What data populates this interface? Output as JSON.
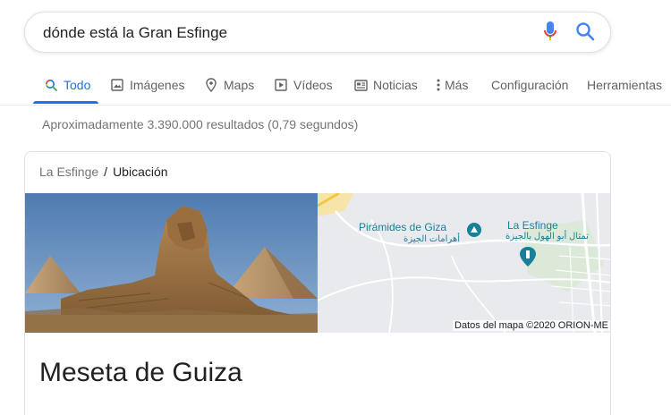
{
  "search": {
    "query": "dónde está la Gran Esfinge"
  },
  "tabs": [
    {
      "label": "Todo",
      "icon": "search-icon",
      "active": true
    },
    {
      "label": "Imágenes",
      "icon": "image-icon"
    },
    {
      "label": "Maps",
      "icon": "map-pin-icon"
    },
    {
      "label": "Vídeos",
      "icon": "play-icon"
    },
    {
      "label": "Noticias",
      "icon": "news-icon"
    },
    {
      "label": "Más",
      "icon": "more-vert-icon"
    },
    {
      "label": "Configuración"
    },
    {
      "label": "Herramientas"
    }
  ],
  "result_stats": "Aproximadamente 3.390.000 resultados (0,79 segundos)",
  "card": {
    "breadcrumb": {
      "parent": "La Esfinge",
      "separator": "/",
      "current": "Ubicación"
    },
    "map": {
      "label_pyramids": "Pirámides de Giza",
      "label_pyramids_ar": "أهرامات الجيزة",
      "label_sphinx": "La Esfinge",
      "label_sphinx_ar": "تمثال أبو الهول بالجيزة",
      "attribution": "Datos del mapa ©2020 ORION-ME"
    },
    "title": "Meseta de Guiza"
  },
  "colors": {
    "accent": "#1a73e8",
    "map_poi": "#188098"
  }
}
